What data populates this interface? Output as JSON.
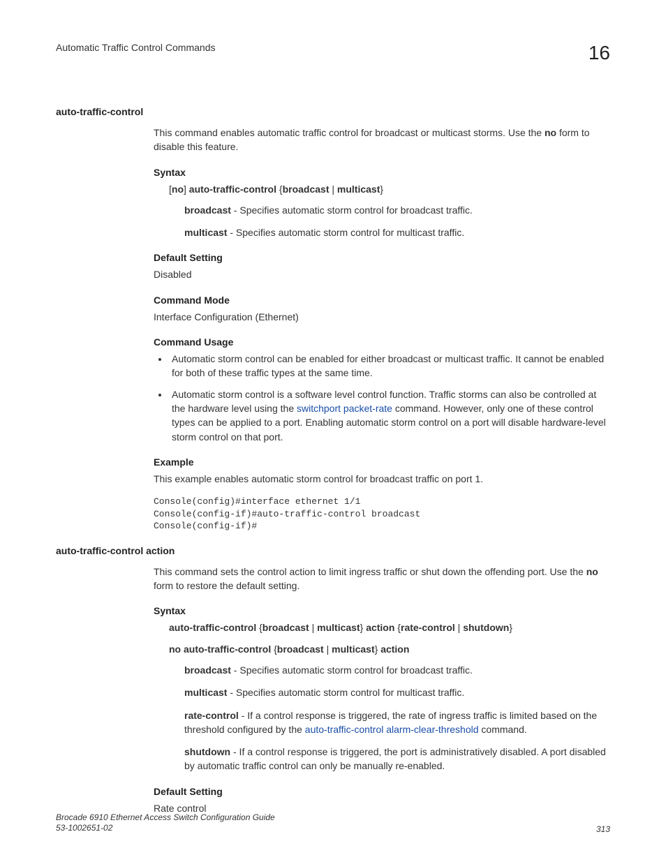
{
  "header": {
    "title": "Automatic Traffic Control Commands",
    "chapter": "16"
  },
  "cmd1": {
    "name": "auto-traffic-control",
    "desc_a": "This command enables automatic traffic control for broadcast or multicast storms. Use the ",
    "desc_no": "no",
    "desc_b": " form to disable this feature.",
    "syntax_head": "Syntax",
    "syntax_pre": "[",
    "syntax_no": "no",
    "syntax_mid": "] ",
    "syntax_cmd": "auto-traffic-control",
    "syntax_args": " {",
    "syntax_b": "broadcast",
    "syntax_pipe": " | ",
    "syntax_m": "multicast",
    "syntax_end": "}",
    "bcast_bold": "broadcast",
    "bcast_txt": " - Specifies automatic storm control for broadcast traffic.",
    "mcast_bold": "multicast",
    "mcast_txt": " - Specifies automatic storm control for multicast traffic.",
    "default_head": "Default Setting",
    "default_val": "Disabled",
    "mode_head": "Command Mode",
    "mode_val": "Interface Configuration (Ethernet)",
    "usage_head": "Command Usage",
    "usage1": "Automatic storm control can be enabled for either broadcast or multicast traffic. It cannot be enabled for both of these traffic types at the same time.",
    "usage2a": "Automatic storm control is a software level control function. Traffic storms can also be controlled at the hardware level using the ",
    "usage2link": "switchport packet-rate",
    "usage2b": " command. However, only one of these control types can be applied to a port. Enabling automatic storm control on a port will disable hardware-level storm control on that port.",
    "example_head": "Example",
    "example_txt": "This example enables automatic storm control for broadcast traffic on port 1.",
    "console": "Console(config)#interface ethernet 1/1\nConsole(config-if)#auto-traffic-control broadcast\nConsole(config-if)#"
  },
  "cmd2": {
    "name": "auto-traffic-control action",
    "desc_a": "This command sets the control action to limit ingress traffic or shut down the offending port. Use the ",
    "desc_no": "no",
    "desc_b": " form to restore the default setting.",
    "syntax_head": "Syntax",
    "s1_cmd": "auto-traffic-control",
    "s1_a": " {",
    "s1_b": "broadcast",
    "s1_pipe1": " | ",
    "s1_m": "multicast",
    "s1_c": "} ",
    "s1_act": "action",
    "s1_d": " {",
    "s1_rc": "rate-control",
    "s1_pipe2": " | ",
    "s1_sd": "shutdown",
    "s1_e": "}",
    "s2_no": "no auto-traffic-control",
    "s2_a": " {",
    "s2_b": "broadcast",
    "s2_pipe": " | ",
    "s2_m": "multicast",
    "s2_c": "} ",
    "s2_act": "action",
    "bcast_bold": "broadcast",
    "bcast_txt": " - Specifies automatic storm control for broadcast traffic.",
    "mcast_bold": "multicast",
    "mcast_txt": " - Specifies automatic storm control for multicast traffic.",
    "rc_bold": "rate-control",
    "rc_a": " - If a control response is triggered, the rate of ingress traffic is limited based on the threshold configured by the ",
    "rc_link": "auto-traffic-control alarm-clear-threshold",
    "rc_b": " command.",
    "sd_bold": "shutdown",
    "sd_txt": " - If a control response is triggered, the port is administratively disabled. A port disabled by automatic traffic control can only be manually re-enabled.",
    "default_head": "Default Setting",
    "default_val": "Rate control"
  },
  "footer": {
    "line1": "Brocade 6910 Ethernet Access Switch Configuration Guide",
    "line2": "53-1002651-02",
    "page": "313"
  }
}
